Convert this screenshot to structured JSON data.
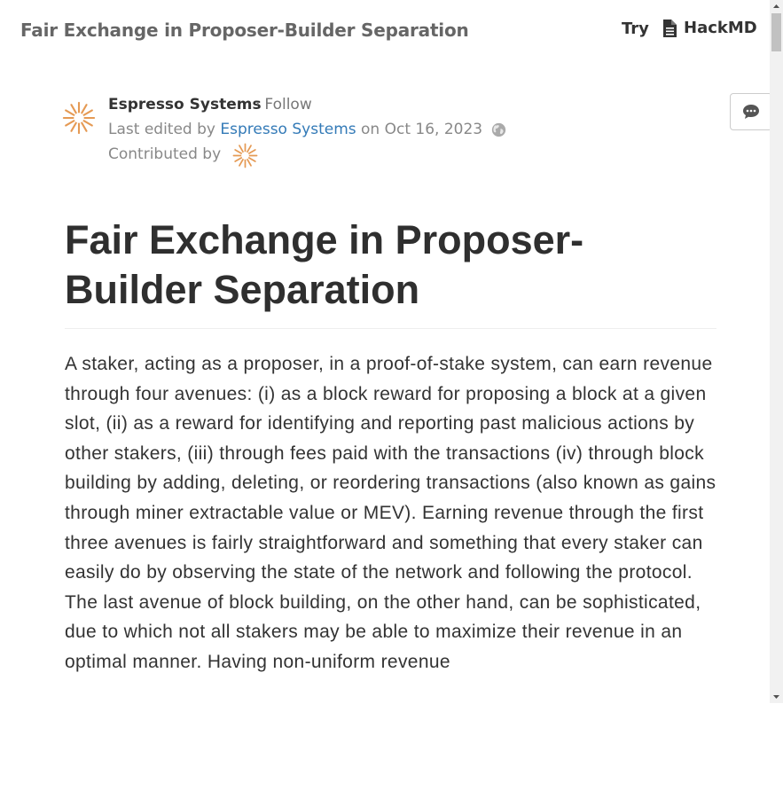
{
  "topbar": {
    "doc_title": "Fair Exchange in Proposer-Builder Separation",
    "try_label": "Try",
    "brand_label": "HackMD",
    "brand_icon": "document-icon"
  },
  "author": {
    "name": "Espresso Systems",
    "follow_label": "Follow",
    "edited_prefix": "Last edited by",
    "edited_by": "Espresso Systems",
    "edited_on_prefix": "on",
    "edited_date": "Oct 16, 2023",
    "contributed_label": "Contributed by",
    "avatar_color": "#e59a54"
  },
  "article": {
    "title": "Fair Exchange in Proposer-Builder Separation",
    "body": "A staker, acting as a proposer, in a proof-of-stake system, can earn revenue through four avenues: (i) as a block reward for proposing a block at a given slot, (ii) as a reward for identifying and reporting past malicious actions by other stakers, (iii) through fees paid with the transactions (iv) through block building by adding, deleting, or reordering transactions (also known as gains through miner extractable value or MEV). Earning revenue through the first three avenues is fairly straightforward and something that every staker can easily do by observing the state of the network and following the protocol. The last avenue of block building, on the other hand, can be sophisticated, due to which not all stakers may be able to maximize their revenue in an optimal manner. Having non-uniform revenue"
  },
  "icons": {
    "comment": "comment-icon",
    "globe": "globe-icon"
  }
}
